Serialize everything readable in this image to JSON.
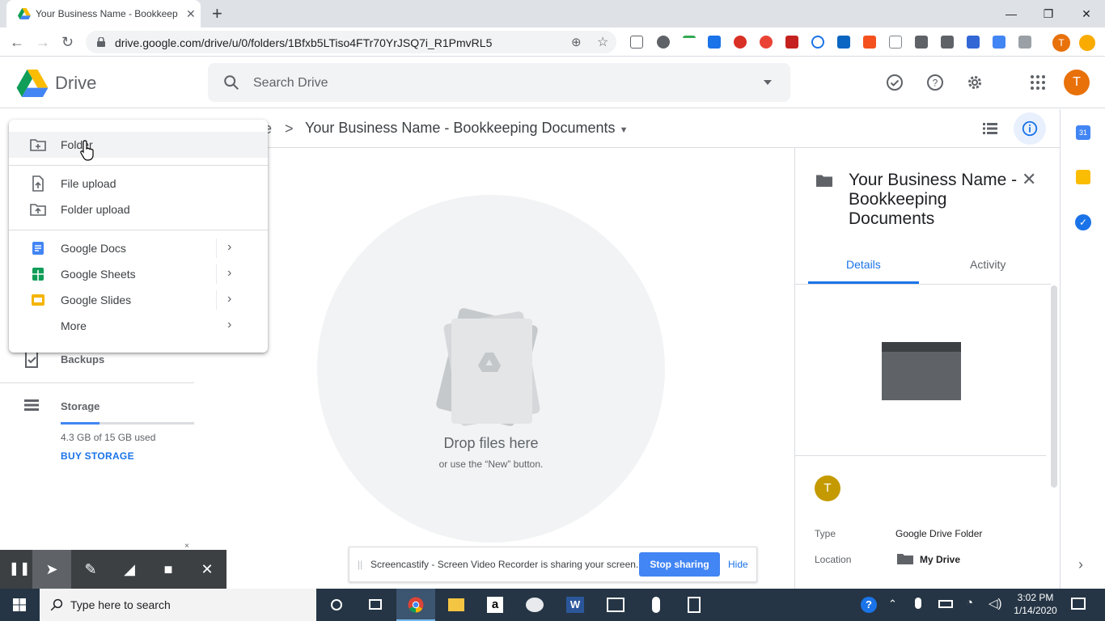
{
  "browser": {
    "tab_title": "Your Business Name - Bookkeep",
    "url": "drive.google.com/drive/u/0/folders/1Bfxb5LTiso4FTr70YrJSQ7i_R1PmvRL5",
    "profile_initial": "T"
  },
  "header": {
    "app_name": "Drive",
    "search_placeholder": "Search Drive",
    "avatar_initial": "T"
  },
  "breadcrumb": {
    "partial": "e",
    "separator": ">",
    "current": "Your Business Name - Bookkeeping Documents"
  },
  "new_menu": {
    "items": [
      {
        "label": "Folder",
        "icon": "new-folder-icon"
      },
      {
        "label": "File upload",
        "icon": "file-upload-icon"
      },
      {
        "label": "Folder upload",
        "icon": "folder-upload-icon"
      },
      {
        "label": "Google Docs",
        "icon": "docs-icon"
      },
      {
        "label": "Google Sheets",
        "icon": "sheets-icon"
      },
      {
        "label": "Google Slides",
        "icon": "slides-icon"
      },
      {
        "label": "More",
        "icon": ""
      }
    ]
  },
  "sidebar": {
    "backups": "Backups",
    "storage": "Storage",
    "storage_used": "4.3 GB of 15 GB used",
    "storage_fraction": 0.29,
    "buy_storage": "BUY STORAGE"
  },
  "empty_state": {
    "title": "Drop files here",
    "subtitle": "or use the “New” button."
  },
  "details": {
    "title": "Your Business Name - Bookkeeping Documents",
    "tabs": [
      "Details",
      "Activity"
    ],
    "owner_initial": "T",
    "type_label": "Type",
    "type_value": "Google Drive Folder",
    "location_label": "Location",
    "location_value": "My Drive"
  },
  "screencastify": {
    "message": "Screencastify - Screen Video Recorder is sharing your screen.",
    "stop_label": "Stop sharing",
    "hide_label": "Hide"
  },
  "taskbar": {
    "search_placeholder": "Type here to search",
    "time": "3:02 PM",
    "date": "1/14/2020"
  },
  "colors": {
    "accent": "#1a73e8",
    "avatar": "#e8710a",
    "taskbar": "#253545"
  }
}
